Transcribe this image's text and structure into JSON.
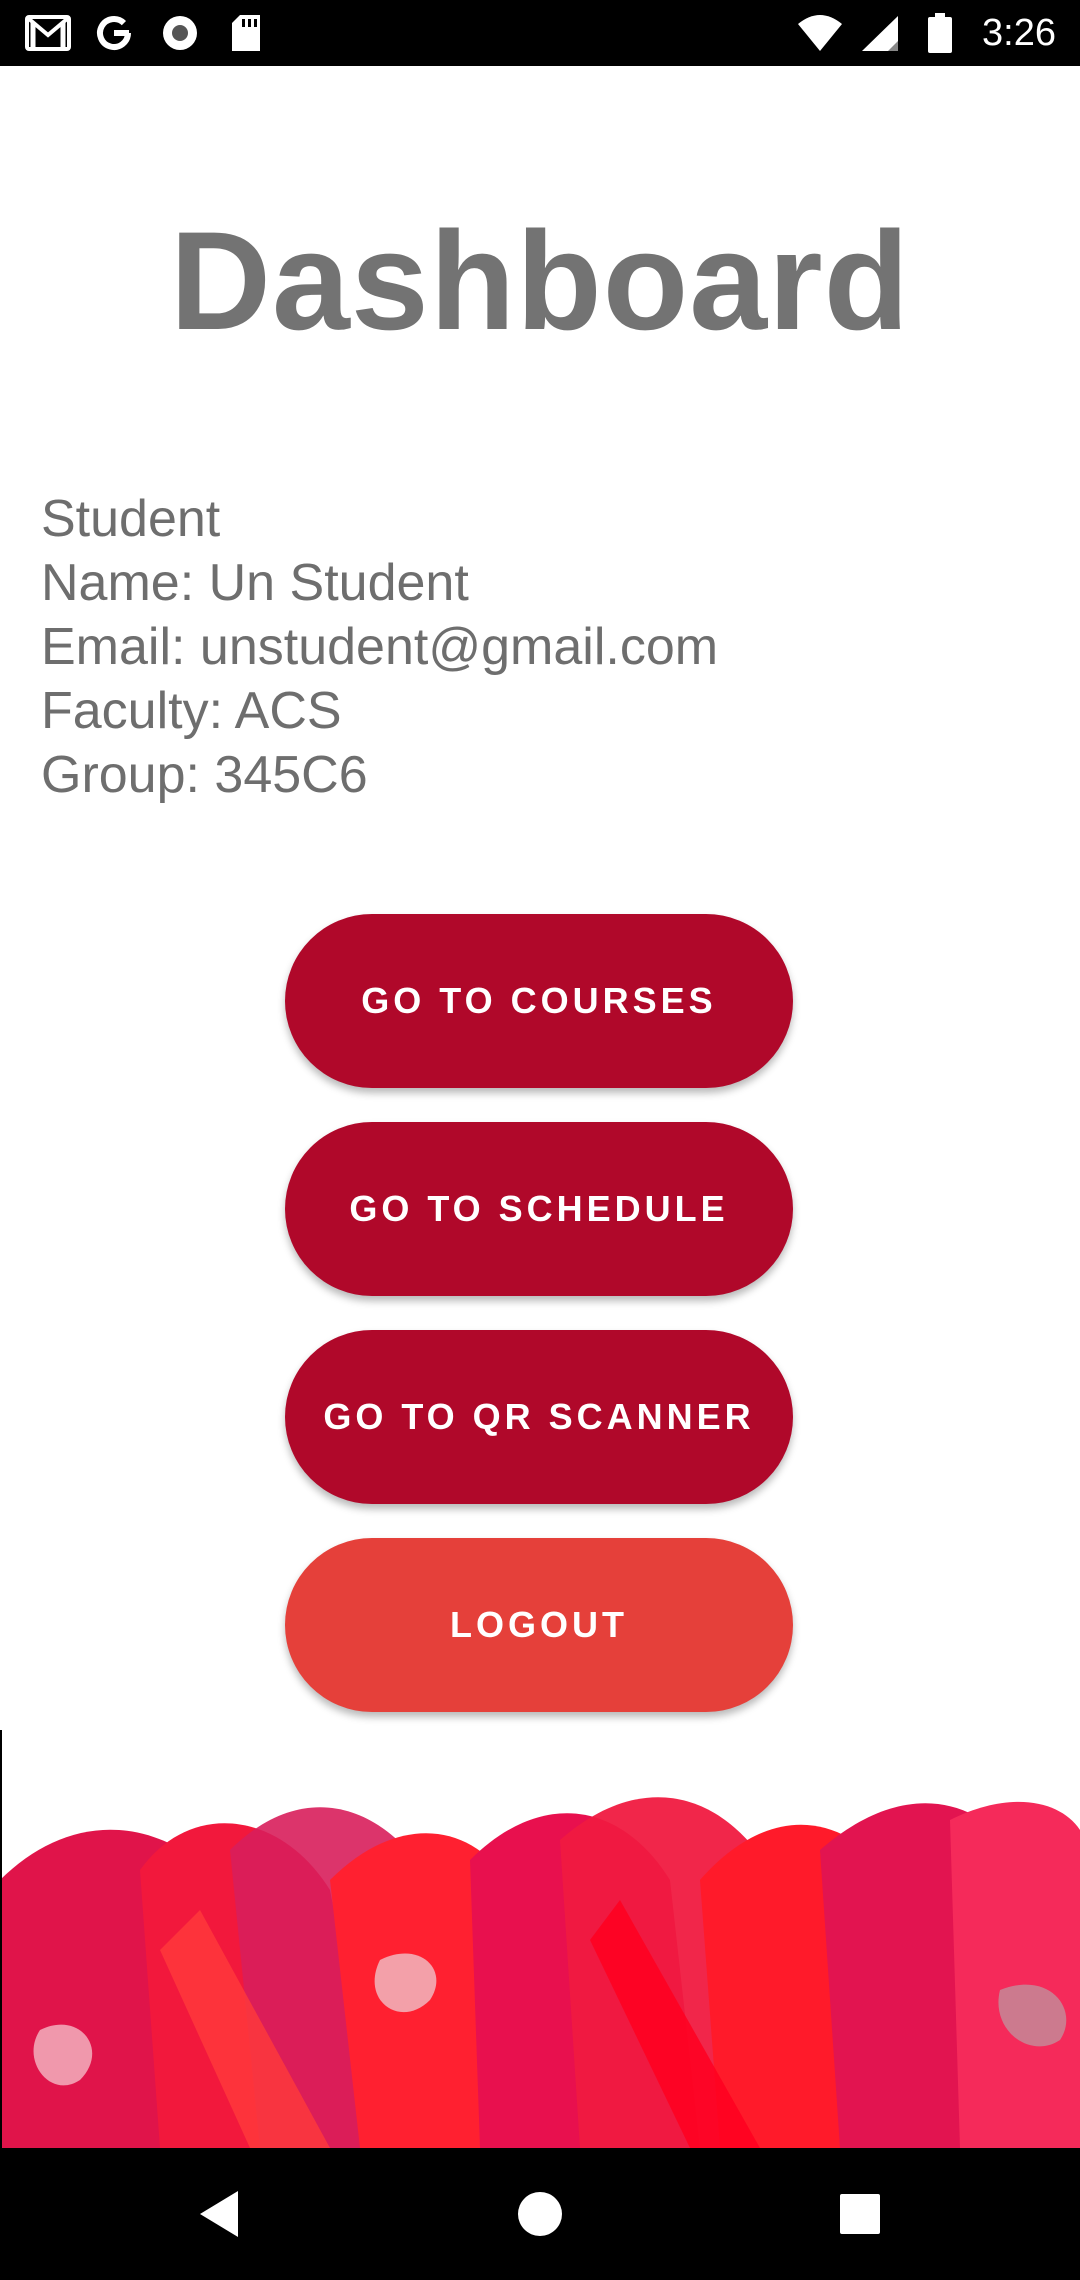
{
  "status_bar": {
    "time": "3:26",
    "left_icons": [
      "gmail-icon",
      "google-icon",
      "record-icon",
      "sd-card-icon"
    ],
    "right_icons": [
      "wifi-icon",
      "cell-signal-icon",
      "battery-icon"
    ]
  },
  "page": {
    "title": "Dashboard"
  },
  "profile": {
    "role": "Student",
    "name": "Name: Un Student",
    "email": "Email: unstudent@gmail.com",
    "faculty": "Faculty: ACS",
    "group": "Group: 345C6"
  },
  "actions": {
    "courses": "GO TO COURSES",
    "schedule": "GO TO SCHEDULE",
    "qr_scanner": "GO TO QR SCANNER",
    "logout": "LOGOUT"
  },
  "colors": {
    "primary_button": "#b0082a",
    "logout_button": "#e5403a",
    "title_text": "#737373"
  },
  "nav_bar": {
    "icons": [
      "back-icon",
      "home-icon",
      "recents-icon"
    ]
  }
}
